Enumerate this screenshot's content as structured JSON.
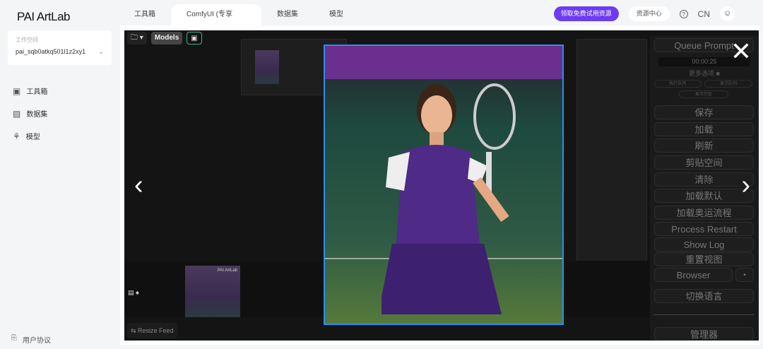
{
  "app": {
    "title": "PAI ArtLab"
  },
  "tabs": [
    {
      "label": "工具箱"
    },
    {
      "label": "ComfyUI (专享版)",
      "close": "×"
    },
    {
      "label": "数据集"
    },
    {
      "label": "模型"
    }
  ],
  "header": {
    "promo": "领取免费试用资源",
    "resource_center": "资源中心",
    "help_icon": "?",
    "lang": "CN",
    "user_icon": "person"
  },
  "workspace": {
    "label": "工作空间",
    "value": "pai_sqb0atkq501l1z2xy1"
  },
  "sidebar": {
    "items": [
      {
        "label": "工具箱",
        "icon": "toolbox-icon"
      },
      {
        "label": "数据集",
        "icon": "image-icon"
      },
      {
        "label": "模型",
        "icon": "model-icon"
      }
    ],
    "footer": "用户协议"
  },
  "comfy": {
    "toolbar": {
      "models": "Models"
    },
    "panel": {
      "queue": "Queue Prompt",
      "timer": "00:00:25",
      "more": "更多选项",
      "exec_queue": "执行队列",
      "show_queue": "显示队列",
      "show_history": "显示历史",
      "buttons": [
        "保存",
        "加载",
        "刷新",
        "剪贴空间",
        "清除",
        "加载默认",
        "加载奥运流程",
        "Process Restart",
        "Show Log",
        "重置视图"
      ],
      "browser": "Browser",
      "switch_lang": "切换语言",
      "manager": "管理器"
    },
    "resize_feed": "Resize Feed",
    "thumb_watermark": "PAI ArtLab"
  },
  "viewer": {
    "close": "✕",
    "prev": "‹",
    "next": "›"
  }
}
